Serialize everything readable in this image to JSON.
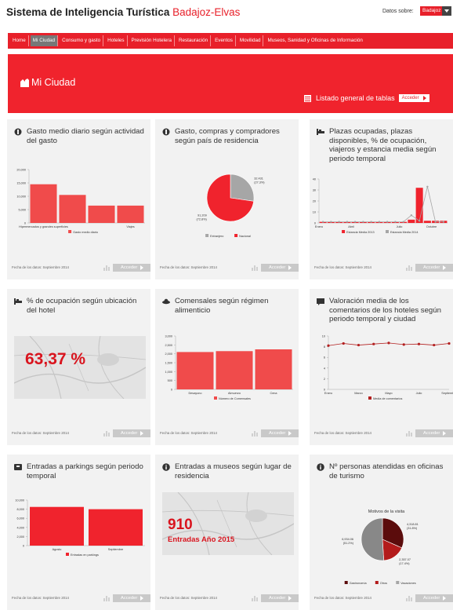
{
  "header": {
    "title_main": "Sistema de Inteligencia Turística",
    "title_accent": "Badajoz-Elvas",
    "datos_label": "Datos sobre:",
    "datos_value": "Badajoz"
  },
  "nav": {
    "items": [
      "Home",
      "Mi Ciudad",
      "Consumo y gasto",
      "Hoteles",
      "Previsión Hotelera",
      "Restauración",
      "Eventos",
      "Movilidad",
      "Museos, Sanidad y Oficinas de Información"
    ],
    "active_index": 1
  },
  "banner": {
    "title": "Mi Ciudad",
    "listado": "Listado general de tablas",
    "listado_button": "Acceder"
  },
  "colors": {
    "accent": "#e8202a",
    "bar": "#f04b4b",
    "gray": "#a6a6a6",
    "dark": "#5b0c0c",
    "line": "#b32020"
  },
  "card_footer": {
    "date": "Fecha de los datos: Septiembre 2014",
    "button": "Acceder"
  },
  "cards": [
    {
      "title": "Gasto medio diario según actividad del gasto",
      "icon": "cash-icon",
      "chart_data": {
        "type": "bar",
        "categories": [
          "Hipermercados y grandes superficies",
          "",
          "",
          "Viajes"
        ],
        "values": [
          14500,
          10500,
          6500,
          6500
        ],
        "ylim": [
          0,
          20000
        ],
        "yticks": [
          "20,000",
          "15,000",
          "10,000",
          "5,000",
          "0"
        ],
        "legend": [
          {
            "name": "Gasto medio diario",
            "color": "#f04b4b"
          }
        ]
      }
    },
    {
      "title": "Gasto, compras y compradores según país de residencia",
      "icon": "cash-icon",
      "chart_data": {
        "type": "pie",
        "slices": [
          {
            "name": "Extranjero",
            "value": 27.3,
            "label": "32.431",
            "pct": "(27.3%)",
            "color": "#a6a6a6"
          },
          {
            "name": "Nacional",
            "value": 72.7,
            "label": "91.209",
            "pct": "(72.8%)",
            "color": "#f0232d"
          }
        ],
        "legend": [
          {
            "name": "Extranjero",
            "color": "#a6a6a6"
          },
          {
            "name": "Nacional",
            "color": "#f0232d"
          }
        ]
      }
    },
    {
      "title": "Plazas ocupadas, plazas disponibles, % de ocupación, viajeros y estancia media según periodo temporal",
      "icon": "bed-icon",
      "chart_data": {
        "type": "bar",
        "categories": [
          "Enero",
          "",
          "Abril",
          "",
          "",
          "Julio",
          "",
          "Octubre",
          ""
        ],
        "series": [
          {
            "name": "Estancia Media 2013",
            "values": [
              1,
              1,
              1,
              1,
              1,
              1,
              1,
              1,
              1,
              1,
              1,
              3,
              32,
              2,
              2,
              2
            ],
            "color": "#f0232d"
          },
          {
            "name": "Estancia Media 2014",
            "values": [
              1,
              1,
              1,
              1,
              1,
              1,
              1,
              1,
              1,
              1,
              1,
              7,
              2,
              33,
              1,
              1
            ],
            "color": "#a6a6a6"
          }
        ],
        "ylim": [
          0,
          40
        ],
        "yticks": [
          "40",
          "30",
          "20",
          "10",
          "0"
        ],
        "legend": [
          {
            "name": "Estancia Media 2013",
            "color": "#f0232d"
          },
          {
            "name": "Estancia Media 2014",
            "color": "#a6a6a6"
          }
        ]
      }
    },
    {
      "title": "% de ocupación según ubicación del hotel",
      "icon": "bed-icon",
      "map_value": "63,37 %"
    },
    {
      "title": "Comensales según régimen alimenticio",
      "icon": "dish-icon",
      "chart_data": {
        "type": "bar",
        "categories": [
          "Desayuno",
          "Almuerzo",
          "Cena"
        ],
        "values": [
          2100,
          2150,
          2250
        ],
        "ylim": [
          0,
          3000
        ],
        "yticks": [
          "3,000",
          "2,500",
          "2,000",
          "1,500",
          "1,000",
          "500",
          "0"
        ],
        "legend": [
          {
            "name": "Número de Comensales",
            "color": "#f04b4b"
          }
        ]
      }
    },
    {
      "title": "Valoración media de los comentarios de los hoteles según periodo temporal y ciudad",
      "icon": "comment-icon",
      "chart_data": {
        "type": "line",
        "categories": [
          "Enero",
          "",
          "Marzo",
          "",
          "Mayo",
          "",
          "Julio",
          "",
          "Septiembre"
        ],
        "values": [
          8.2,
          8.6,
          8.3,
          8.5,
          8.7,
          8.4,
          8.5,
          8.3,
          8.6
        ],
        "ylim": [
          0,
          10
        ],
        "yticks": [
          "10",
          "8",
          "6",
          "4",
          "2",
          "0"
        ],
        "legend": [
          {
            "name": "Media de comentarios",
            "color": "#b32020"
          }
        ]
      }
    },
    {
      "title": "Entradas a parkings según periodo temporal",
      "icon": "parking-icon",
      "chart_data": {
        "type": "bar",
        "categories": [
          "Agosto",
          "Septiembre"
        ],
        "values": [
          8500,
          8000
        ],
        "ylim": [
          0,
          10000
        ],
        "yticks": [
          "10,000",
          "8,000",
          "6,000",
          "4,000",
          "2,000",
          "0"
        ],
        "legend": [
          {
            "name": "Entradas en parkings",
            "color": "#f0232d"
          }
        ]
      }
    },
    {
      "title": "Entradas a museos según lugar de residencia",
      "icon": "info-icon",
      "map_value": "910",
      "map_sub": "Entradas Año 2015"
    },
    {
      "title": "Nº personas atendidas en oficinas de turismo",
      "icon": "info-icon",
      "chart_data": {
        "type": "pie",
        "title": "Motivos de la visita",
        "slices": [
          {
            "name": "Gastronomía",
            "value": 31.6,
            "label": "4,318.81",
            "pct": "(31.8%)",
            "color": "#5b0c0c"
          },
          {
            "name": "Otros",
            "value": 17.4,
            "label": "2,357.07",
            "pct": "(17.4%)",
            "color": "#b31b1b"
          },
          {
            "name": "Vacaciones",
            "value": 51.0,
            "label": "6,934.06",
            "pct": "(51.2%)",
            "color": "#888888"
          }
        ],
        "legend": [
          {
            "name": "Gastronomía",
            "color": "#5b0c0c"
          },
          {
            "name": "Otros",
            "color": "#b31b1b"
          },
          {
            "name": "Vacaciones",
            "color": "#a6a6a6"
          }
        ]
      }
    }
  ]
}
